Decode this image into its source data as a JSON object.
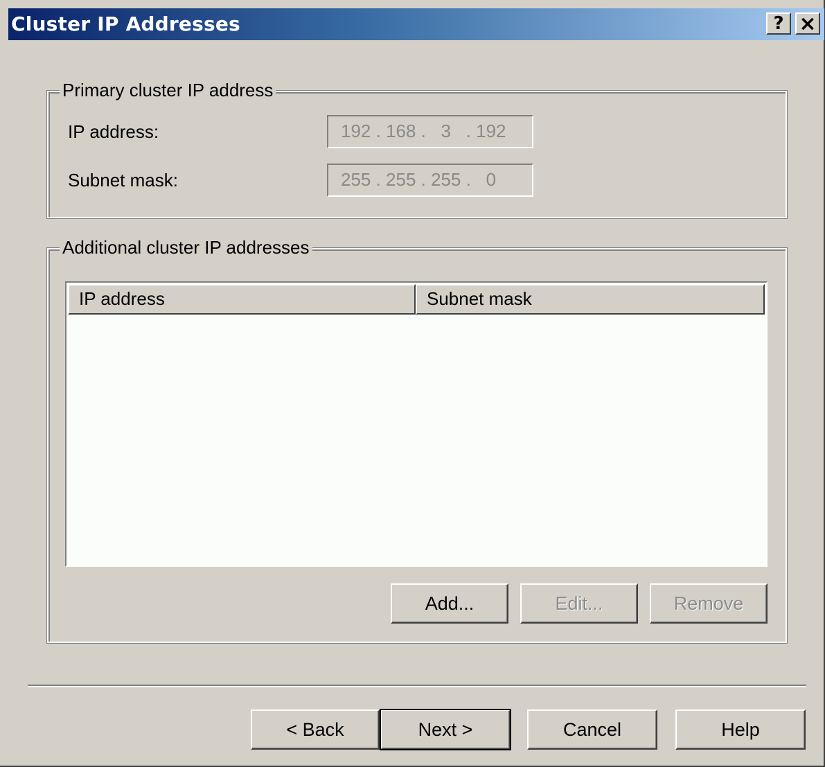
{
  "window": {
    "title": "Cluster IP Addresses",
    "help_glyph": "?",
    "close_glyph": "×"
  },
  "primary_group": {
    "legend": "Primary cluster IP address",
    "ip_label": "IP address:",
    "ip_value": "192 . 168 .   3   . 192",
    "mask_label": "Subnet mask:",
    "mask_value": "255 . 255 . 255 .   0"
  },
  "additional_group": {
    "legend": "Additional cluster IP addresses",
    "columns": [
      "IP address",
      "Subnet mask"
    ],
    "rows": [],
    "add_label": "Add...",
    "edit_label": "Edit...",
    "remove_label": "Remove"
  },
  "footer": {
    "back_label": "< Back",
    "next_label": "Next >",
    "cancel_label": "Cancel",
    "help_label": "Help"
  },
  "colors": {
    "face": "#d4d0c8",
    "title_start": "#0a246a",
    "title_end": "#a6caf0",
    "disabled_text": "#8c8c8c"
  }
}
